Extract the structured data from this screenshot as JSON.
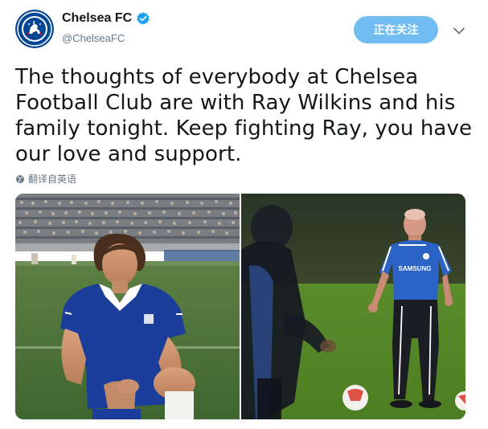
{
  "account": {
    "display_name": "Chelsea FC",
    "handle": "@ChelseaFC",
    "verified": true,
    "avatar_icon": "chelsea-crest-icon"
  },
  "follow_button": {
    "label": "正在关注",
    "color": "#71bcf0"
  },
  "tweet": {
    "text": "The thoughts of everybody at Chelsea Football Club are with Ray Wilkins and his family tonight. Keep fighting Ray, you have our love and support.",
    "lines": [
      "The thoughts of everybody at Chelsea",
      "Football Club are with Ray Wilkins and his",
      "family tonight. Keep fighting Ray, you have",
      "our love and support."
    ],
    "translate_label": "翻译自英语"
  },
  "media": {
    "photos": [
      {
        "name": "vintage-player-photo",
        "sponsor_text": ""
      },
      {
        "name": "coach-training-photo",
        "shirt_text": "SAMSUNG"
      }
    ]
  },
  "colors": {
    "brand_blue": "#034694",
    "link_gray": "#657786",
    "verified_blue": "#1da1f2"
  }
}
